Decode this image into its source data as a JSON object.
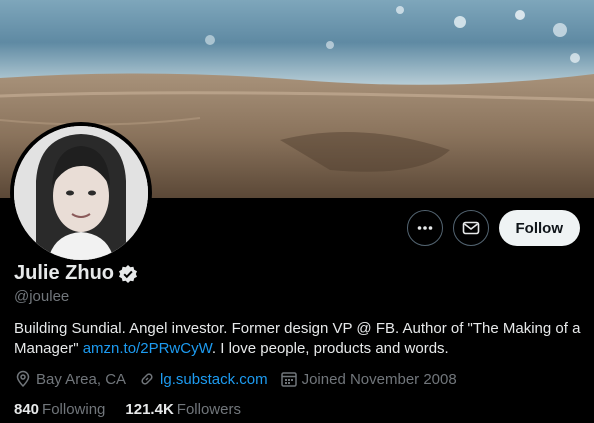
{
  "profile": {
    "name": "Julie Zhuo",
    "handle": "@joulee",
    "verified": true,
    "bio_text": "Building Sundial. Angel investor. Former design VP @ FB. Author of \"The Making of a Manager\"",
    "bio_link": "amzn.to/2PRwCyW",
    "bio_tail": ". I love people, products and words.",
    "location": "Bay Area, CA",
    "website": "lg.substack.com",
    "joined": "Joined November 2008"
  },
  "stats": {
    "following_count": "840",
    "following_label": "Following",
    "followers_count": "121.4K",
    "followers_label": "Followers"
  },
  "actions": {
    "follow_label": "Follow",
    "more_icon": "more-icon",
    "message_icon": "envelope-icon"
  },
  "colors": {
    "background": "#000000",
    "link": "#1d9bf0",
    "muted": "#71767b",
    "verified_badge": "#e7e9ea"
  }
}
